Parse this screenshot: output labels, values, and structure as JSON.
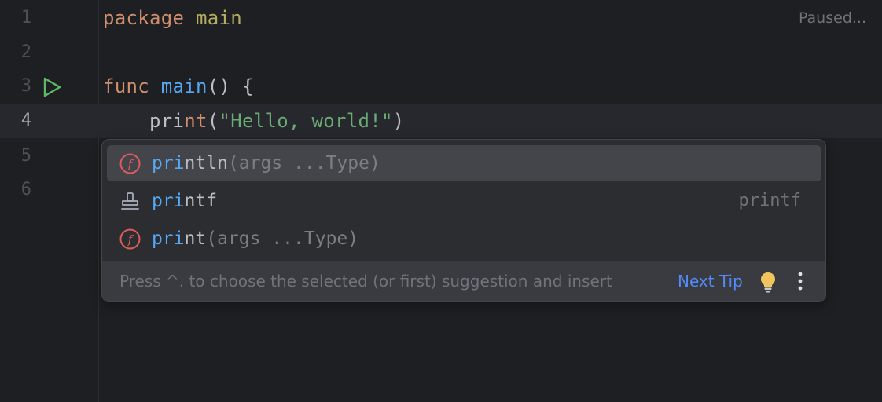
{
  "editor": {
    "status": "Paused...",
    "lines": [
      {
        "number": "1",
        "parts": [
          {
            "text": "package",
            "style": "kw"
          },
          {
            "text": " ",
            "style": "plain"
          },
          {
            "text": "main",
            "style": "pkg"
          }
        ]
      },
      {
        "number": "2",
        "parts": []
      },
      {
        "number": "3",
        "parts": [
          {
            "text": "func",
            "style": "kw"
          },
          {
            "text": " ",
            "style": "plain"
          },
          {
            "text": "main",
            "style": "fn"
          },
          {
            "text": "() {",
            "style": "plain"
          }
        ]
      },
      {
        "number": "4",
        "parts": [
          {
            "text": "    pri",
            "style": "typed"
          },
          {
            "text": "nt",
            "style": "hint"
          },
          {
            "text": "(",
            "style": "plain"
          },
          {
            "text": "\"Hello, world!\"",
            "style": "str"
          },
          {
            "text": ")",
            "style": "plain"
          }
        ]
      },
      {
        "number": "5",
        "parts": []
      },
      {
        "number": "6",
        "parts": []
      }
    ],
    "run_icon": "run-triangle-icon"
  },
  "completion": {
    "items": [
      {
        "icon": "function-icon",
        "match": "pri",
        "rest": "ntln",
        "signature": "(args ...Type)",
        "right": ""
      },
      {
        "icon": "template-stamp-icon",
        "match": "pri",
        "rest": "ntf",
        "signature": "",
        "right": "printf"
      },
      {
        "icon": "function-icon",
        "match": "pri",
        "rest": "nt",
        "signature": "(args ...Type)",
        "right": ""
      }
    ],
    "footer_hint": "Press ^. to choose the selected (or first) suggestion and insert",
    "next_tip": "Next Tip",
    "colors": {
      "function_icon": "#db5c5c",
      "match": "#56a8f5",
      "bulb": "#f2c55c",
      "link": "#548af7"
    }
  }
}
